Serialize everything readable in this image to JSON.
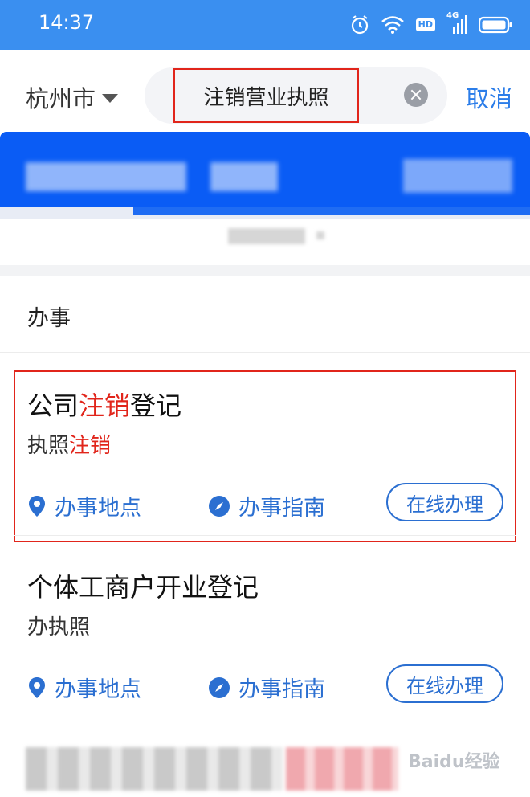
{
  "status_bar": {
    "time": "14:37",
    "icons": [
      "alarm-icon",
      "wifi-icon",
      "hd-icon",
      "signal-4g-icon",
      "battery-icon"
    ],
    "hd_label": "HD",
    "net_label": "4G"
  },
  "header": {
    "city": "杭州市",
    "search_value": "注销营业执照",
    "cancel_label": "取消"
  },
  "section": {
    "title": "办事"
  },
  "results": [
    {
      "title_parts": [
        "公司",
        "注销",
        "登记"
      ],
      "sub_parts": [
        "执照",
        "注销"
      ],
      "location_label": "办事地点",
      "guide_label": "办事指南",
      "online_label": "在线办理"
    },
    {
      "title": "个体工商户开业登记",
      "sub": "办执照",
      "location_label": "办事地点",
      "guide_label": "办事指南",
      "online_label": "在线办理"
    }
  ],
  "watermark": "Baidu经验",
  "colors": {
    "status_bar": "#3a8ff0",
    "banner": "#0a5cf5",
    "accent_blue": "#2b6fd1",
    "highlight_red": "#e1251b"
  }
}
